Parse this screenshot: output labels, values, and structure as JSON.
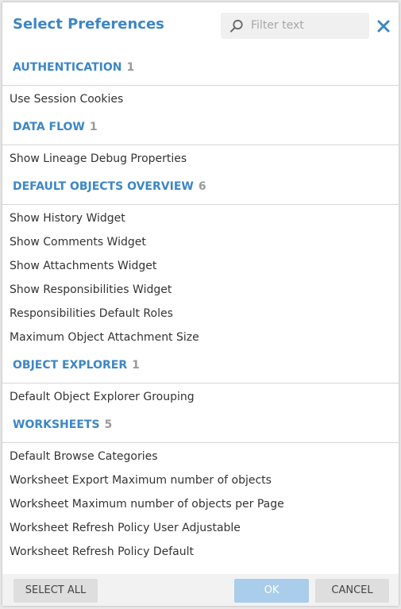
{
  "dialog": {
    "title": "Select Preferences",
    "close_icon": "close-icon",
    "filter": {
      "placeholder": "Filter text",
      "value": "",
      "icon": "search-icon"
    }
  },
  "colors": {
    "accent": "#3d86c6",
    "count": "#9a9a9a",
    "ok_button": "#a9cdea"
  },
  "sections": [
    {
      "name": "AUTHENTICATION",
      "count": "1",
      "items": [
        "Use Session Cookies"
      ]
    },
    {
      "name": "DATA FLOW",
      "count": "1",
      "items": [
        "Show Lineage Debug Properties"
      ]
    },
    {
      "name": "DEFAULT OBJECTS OVERVIEW",
      "count": "6",
      "items": [
        "Show History Widget",
        "Show Comments Widget",
        "Show Attachments Widget",
        "Show Responsibilities Widget",
        "Responsibilities Default Roles",
        "Maximum Object Attachment Size"
      ]
    },
    {
      "name": "OBJECT EXPLORER",
      "count": "1",
      "items": [
        "Default Object Explorer Grouping"
      ]
    },
    {
      "name": "WORKSHEETS",
      "count": "5",
      "items": [
        "Default Browse Categories",
        "Worksheet Export Maximum number of objects",
        "Worksheet Maximum number of objects per Page",
        "Worksheet Refresh Policy User Adjustable",
        "Worksheet Refresh Policy Default"
      ]
    }
  ],
  "footer": {
    "select_all_label": "SELECT ALL",
    "ok_label": "OK",
    "cancel_label": "CANCEL"
  }
}
